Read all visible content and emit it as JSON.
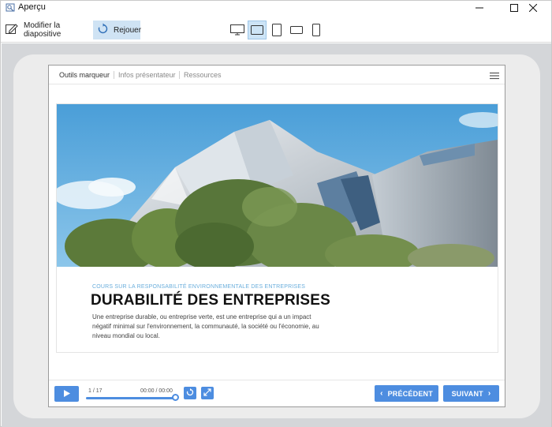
{
  "window": {
    "title": "Aperçu"
  },
  "toolbar": {
    "edit_label": "Modifier la diapositive",
    "replay_label": "Rejouer",
    "devices": [
      "desktop-icon",
      "tablet-landscape-icon",
      "tablet-portrait-icon",
      "phone-landscape-icon",
      "phone-portrait-icon"
    ],
    "active_device": "tablet-landscape-icon"
  },
  "player": {
    "tabs": [
      "Outils marqueur",
      "Infos présentateur",
      "Ressources"
    ],
    "slide_counter": "1 / 17",
    "time": "00:00 / 00:00",
    "progress": 1.0,
    "prev_label": "PRÉCÉDENT",
    "next_label": "SUIVANT"
  },
  "slide": {
    "subtitle": "COURS SUR LA RESPONSABILITÉ ENVIRONNEMENTALE DES ENTREPRISES",
    "title": "DURABILITÉ DES ENTREPRISES",
    "body": "Une entreprise durable, ou entreprise verte, est une entreprise qui a un impact négatif minimal sur l'environnement, la communauté, la société ou l'économie, au niveau mondial ou local."
  },
  "colors": {
    "accent": "#4d8de0",
    "subtitle": "#6aaedc",
    "active_tool": "#cfe3f4",
    "backdrop": "#d4d6d9"
  }
}
